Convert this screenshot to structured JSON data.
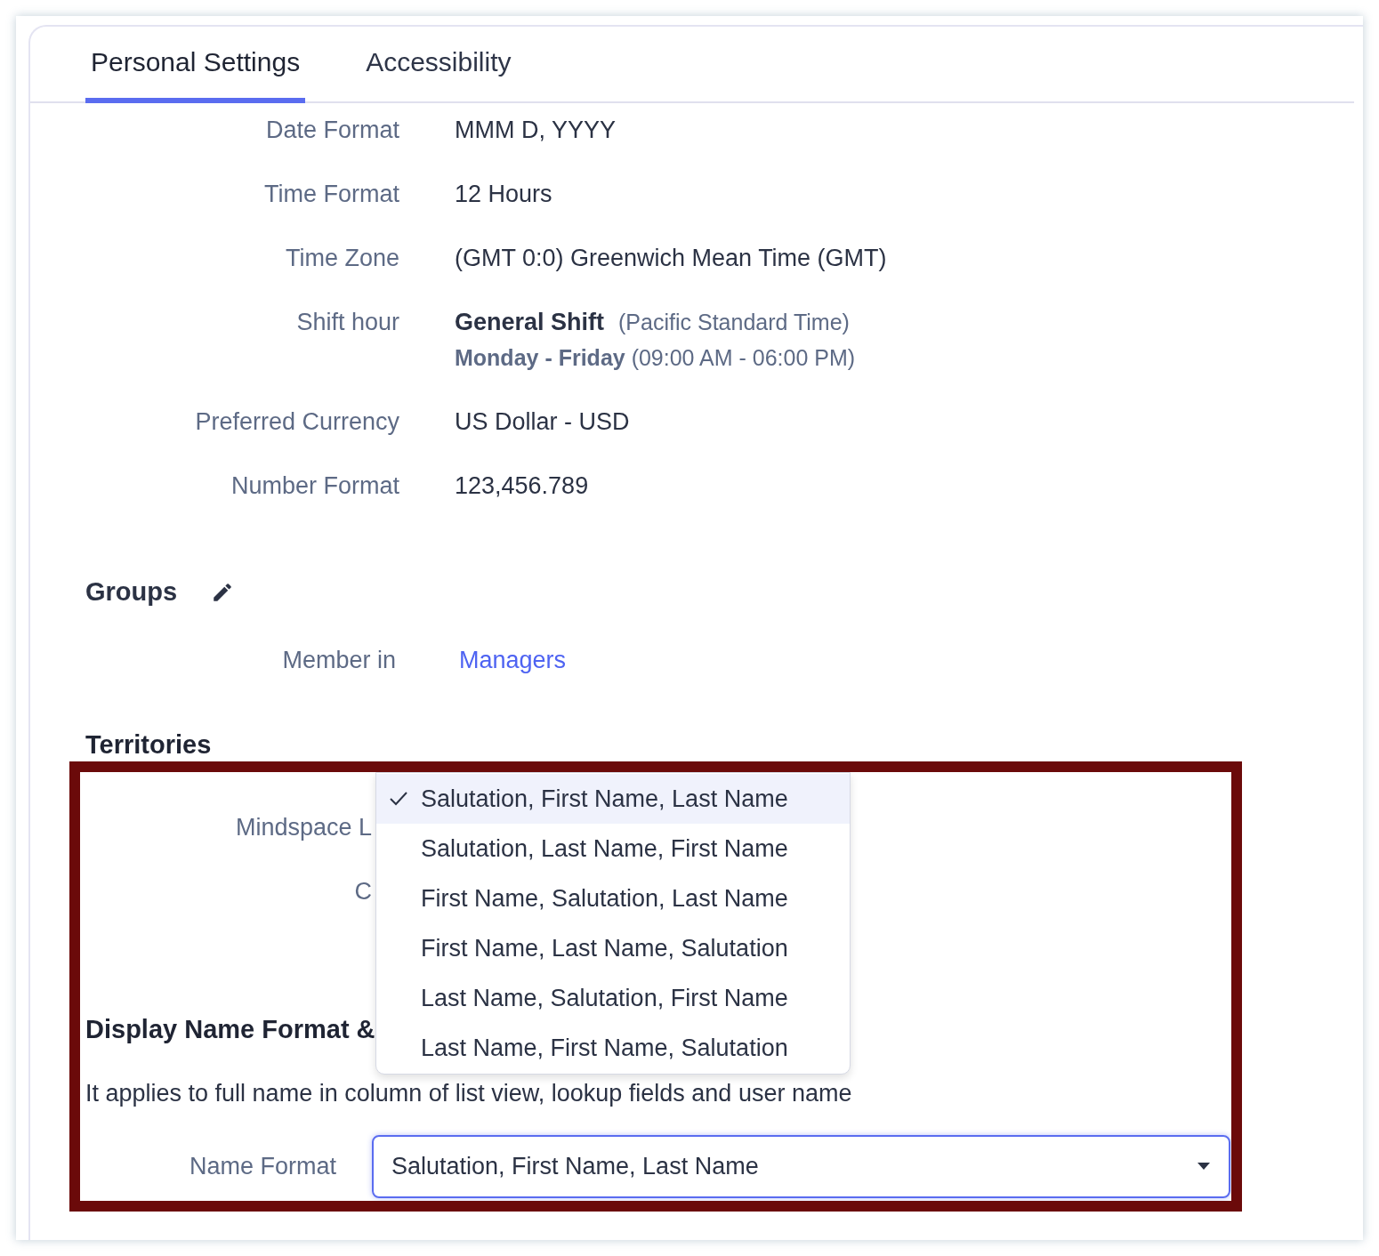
{
  "tabs": [
    {
      "label": "Personal Settings",
      "selected": true
    },
    {
      "label": "Accessibility",
      "selected": false
    }
  ],
  "settings": [
    {
      "label": "Date Format",
      "value": "MMM D, YYYY"
    },
    {
      "label": "Time Format",
      "value": "12 Hours"
    },
    {
      "label": "Time Zone",
      "value": "(GMT 0:0) Greenwich Mean Time (GMT)"
    },
    {
      "label": "Shift hour",
      "kind": "shift",
      "shift_name": "General Shift",
      "shift_zone": "(Pacific Standard Time)",
      "days": "**Monday - Friday** (09:00 AM - 06:00 PM)"
    },
    {
      "label": "Preferred Currency",
      "value": "US Dollar - USD"
    },
    {
      "label": "Number Format",
      "value": "123,456.789"
    }
  ],
  "groups": {
    "title": "Groups",
    "member_label": "Member in",
    "member_link": "Managers"
  },
  "territories": {
    "title": "Territories",
    "rows": [
      "Mindspace L",
      "C"
    ]
  },
  "display_name": {
    "title": "Display Name Format &",
    "description": "It applies to full name in column of list view, lookup fields and user name",
    "field_label": "Name Format",
    "field_value": "Salutation, First Name, Last Name"
  },
  "dropdown_options": [
    {
      "label": "Salutation, First Name, Last Name",
      "selected": true
    },
    {
      "label": "Salutation, Last Name, First Name",
      "selected": false
    },
    {
      "label": "First Name, Salutation, Last Name",
      "selected": false
    },
    {
      "label": "First Name, Last Name, Salutation",
      "selected": false
    },
    {
      "label": "Last Name, Salutation, First Name",
      "selected": false
    },
    {
      "label": "Last Name, First Name, Salutation",
      "selected": false
    }
  ]
}
